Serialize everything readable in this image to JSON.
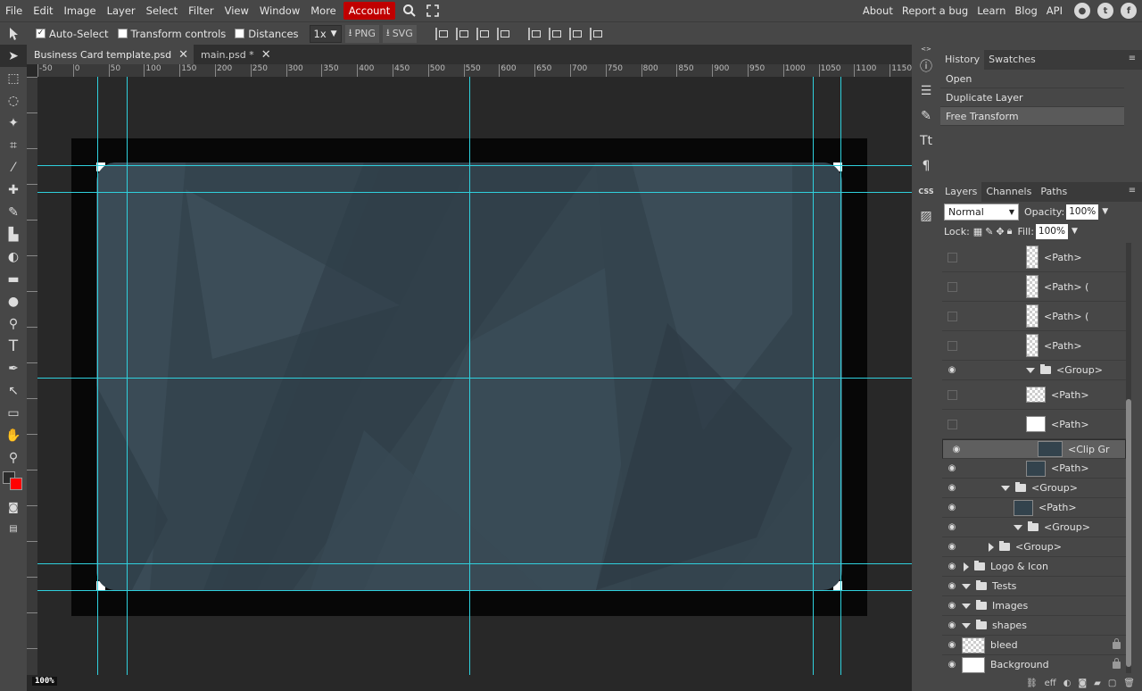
{
  "menu": [
    "File",
    "Edit",
    "Image",
    "Layer",
    "Select",
    "Filter",
    "View",
    "Window",
    "More"
  ],
  "account_label": "Account",
  "menu_right": [
    "About",
    "Report a bug",
    "Learn",
    "Blog",
    "API"
  ],
  "options": {
    "auto_select": "Auto-Select",
    "transform_controls": "Transform controls",
    "distances": "Distances",
    "scale": "1x",
    "png": "PNG",
    "svg": "SVG"
  },
  "tabs": [
    {
      "label": "Business Card template.psd"
    },
    {
      "label": "main.psd *"
    }
  ],
  "ruler_h": [
    "-50",
    "0",
    "50",
    "100",
    "150",
    "200",
    "250",
    "300",
    "350",
    "400",
    "450",
    "500",
    "550",
    "600",
    "650",
    "700",
    "750",
    "800",
    "850",
    "900",
    "950",
    "1000",
    "1050",
    "1100",
    "1150"
  ],
  "zoom": "100%",
  "panels": {
    "history_tab": "History",
    "swatches_tab": "Swatches",
    "history": [
      "Open",
      "Duplicate Layer",
      "Free Transform"
    ],
    "layers_tab": "Layers",
    "channels_tab": "Channels",
    "paths_tab": "Paths",
    "blend_mode": "Normal",
    "opacity_label": "Opacity:",
    "opacity": "100%",
    "lock_label": "Lock:",
    "fill_label": "Fill:",
    "fill": "100%"
  },
  "layers": [
    {
      "name": "<Path>"
    },
    {
      "name": "<Path> ("
    },
    {
      "name": "<Path> ("
    },
    {
      "name": "<Path>"
    },
    {
      "name": "<Group>"
    },
    {
      "name": "<Path>"
    },
    {
      "name": "<Path>"
    },
    {
      "name": "<Clip Gr"
    },
    {
      "name": "<Path>"
    },
    {
      "name": "<Group>"
    },
    {
      "name": "<Path>"
    },
    {
      "name": "<Group>"
    },
    {
      "name": "<Group>"
    },
    {
      "name": "Logo & Icon"
    },
    {
      "name": "Tests"
    },
    {
      "name": "Images"
    },
    {
      "name": "shapes"
    },
    {
      "name": "bleed"
    },
    {
      "name": "Background"
    }
  ],
  "footer_label": "eff",
  "colors": {
    "accent": "#c00000",
    "guide": "#2fd0dd",
    "card": "#35454f",
    "fg": "#2b2b2b",
    "bg": "#ff0000"
  }
}
